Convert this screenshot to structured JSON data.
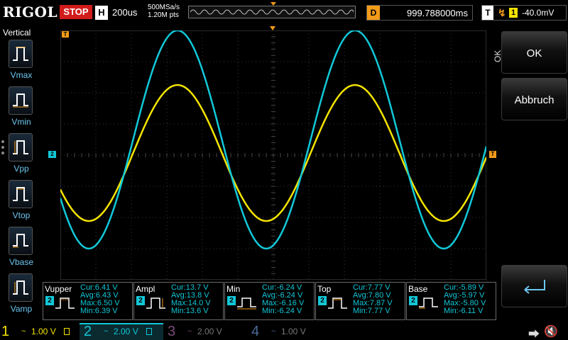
{
  "topbar": {
    "brand": "RIGOL",
    "run_status": "STOP",
    "horizontal_label": "H",
    "timebase": "200us",
    "sample_rate": "500MSa/s",
    "memory_depth": "1.20M pts",
    "delay_label": "D",
    "delay_value": "999.788000ms",
    "trigger_label": "T",
    "trigger_source": "1",
    "trigger_level": "-40.0mV"
  },
  "left_menu": {
    "title": "Vertical",
    "items": [
      {
        "label": "Vmax"
      },
      {
        "label": "Vmin"
      },
      {
        "label": "Vpp"
      },
      {
        "label": "Vtop"
      },
      {
        "label": "Vbase"
      },
      {
        "label": "Vamp"
      }
    ]
  },
  "right_panel": {
    "side_label": "OK",
    "ok_label": "OK",
    "cancel_label": "Abbruch"
  },
  "grid_markers": {
    "ch2_marker": "2",
    "trig_level_marker": "T",
    "trig_pos_marker": "T"
  },
  "measurements": [
    {
      "name": "Vupper",
      "channel": "2",
      "cur": "Cur:6.41 V",
      "avg": "Avg:6.43 V",
      "max": "Max:6.50 V",
      "min": "Min:6.39 V"
    },
    {
      "name": "Ampl",
      "channel": "2",
      "cur": "Cur:13.7 V",
      "avg": "Avg:13.8 V",
      "max": "Max:14.0 V",
      "min": "Min:13.6 V"
    },
    {
      "name": "Min",
      "channel": "2",
      "cur": "Cur:-6.24 V",
      "avg": "Avg:-6.24 V",
      "max": "Max:-6.16 V",
      "min": "Min:-6.24 V"
    },
    {
      "name": "Top",
      "channel": "2",
      "cur": "Cur:7.77 V",
      "avg": "Avg:7.80 V",
      "max": "Max:7.87 V",
      "min": "Min:7.77 V"
    },
    {
      "name": "Base",
      "channel": "2",
      "cur": "Cur:-5.89 V",
      "avg": "Avg:-5.97 V",
      "max": "Max:-5.80 V",
      "min": "Min:-6.11 V"
    }
  ],
  "channels": [
    {
      "num": "1",
      "coupling": "~",
      "scale": "1.00 V",
      "color": "#f4e400",
      "active": true
    },
    {
      "num": "2",
      "coupling": "~",
      "scale": "2.00 V",
      "color": "#11c8d8",
      "active": true
    },
    {
      "num": "3",
      "coupling": "~",
      "scale": "2.00 V",
      "color": "#c21ecb",
      "active": false
    },
    {
      "num": "4",
      "coupling": "~",
      "scale": "1.00 V",
      "color": "#2a6bd8",
      "active": false
    }
  ],
  "colors": {
    "ch1": "#f4e400",
    "ch2": "#11c8d8",
    "trigger": "#f29b18",
    "stop": "#d21b1b"
  },
  "icons": {
    "usb": "usb-icon",
    "speaker_muted": "speaker-muted-icon",
    "enter": "enter-icon"
  }
}
